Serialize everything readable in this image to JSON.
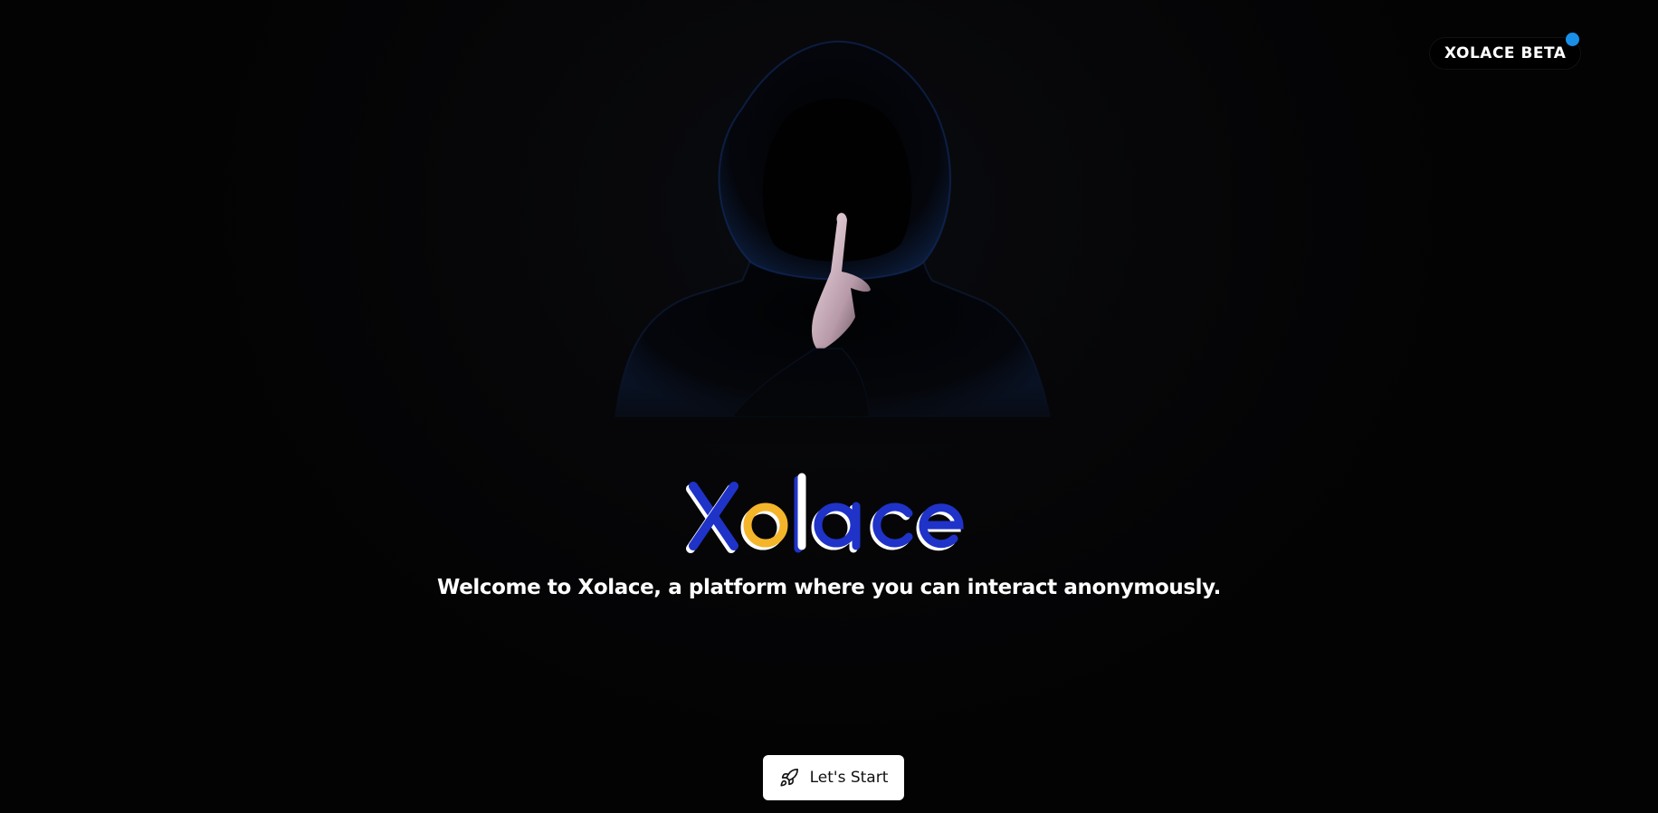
{
  "badge": {
    "label": "XOLACE BETA",
    "dot_color": "#1a8fe8"
  },
  "hero": {
    "image": "hooded-figure-shush-icon",
    "logo_text": "Xolace",
    "logo_colors": {
      "primary": "#1f33c9",
      "accent": "#f4b52a",
      "white": "#ffffff"
    },
    "tagline": "Welcome to Xolace, a platform where you can interact anonymously."
  },
  "cta": {
    "label": "Let's Start",
    "icon": "rocket-icon"
  },
  "colors": {
    "background": "#050506",
    "button_bg": "#ffffff",
    "button_text": "#111111"
  }
}
